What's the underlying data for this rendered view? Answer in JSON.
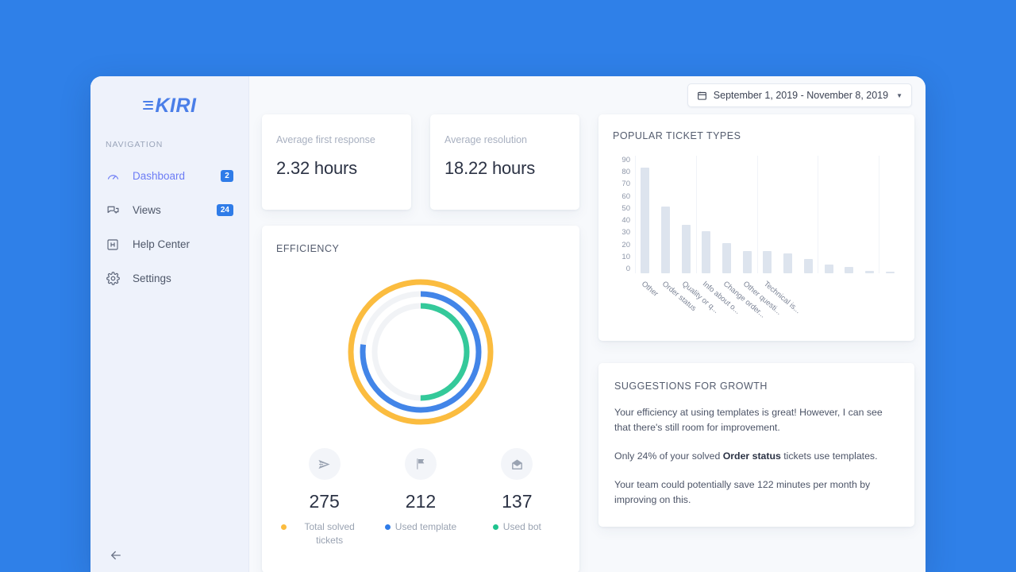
{
  "brand": {
    "name": "KIRI",
    "color": "#4a7ee8"
  },
  "sidebar": {
    "section_label": "NAVIGATION",
    "collapse_icon": "arrow-left-icon",
    "items": [
      {
        "label": "Dashboard",
        "badge": "2",
        "icon": "gauge-icon",
        "active": true
      },
      {
        "label": "Views",
        "badge": "24",
        "icon": "chat-bubbles-icon",
        "active": false
      },
      {
        "label": "Help Center",
        "badge": "",
        "icon": "help-box-icon",
        "active": false
      },
      {
        "label": "Settings",
        "badge": "",
        "icon": "gear-icon",
        "active": false
      }
    ]
  },
  "topbar": {
    "date_range": "September 1, 2019 - November 8, 2019",
    "calendar_icon": "calendar-icon",
    "caret_icon": "chevron-down-icon"
  },
  "metrics": [
    {
      "label": "Average first response",
      "value": "2.32 hours"
    },
    {
      "label": "Average resolution",
      "value": "18.22 hours"
    }
  ],
  "efficiency": {
    "title": "EFFICIENCY",
    "rings": [
      {
        "name": "Total solved tickets",
        "percent": 100,
        "color": "#fbbc3f"
      },
      {
        "name": "Used template",
        "percent": 77,
        "color": "#4285e8"
      },
      {
        "name": "Used bot",
        "percent": 50,
        "color": "#34c99a"
      }
    ],
    "stats": [
      {
        "value": "275",
        "label": "Total solved tickets",
        "color": "#fbbc3f",
        "icon": "send-icon"
      },
      {
        "value": "212",
        "label": "Used template",
        "color": "#2f7ce8",
        "icon": "flag-icon"
      },
      {
        "value": "137",
        "label": "Used bot",
        "color": "#1fc38e",
        "icon": "envelope-icon"
      }
    ]
  },
  "suggestions": {
    "title": "SUGGESTIONS FOR GROWTH",
    "paragraphs": [
      "Your efficiency at using templates is great! However, I can see that there's still room for improvement.",
      "Only 24% of your solved ",
      " tickets use templates.",
      "Your team could potentially save 122 minutes per month by improving on this."
    ],
    "highlight": "Order status"
  },
  "chart_data": {
    "type": "bar",
    "title": "POPULAR TICKET TYPES",
    "xlabel": "",
    "ylabel": "",
    "ylim": [
      0,
      90
    ],
    "yticks": [
      90,
      80,
      70,
      60,
      50,
      40,
      30,
      20,
      10,
      0
    ],
    "grid": "vertical-light",
    "legend": "none",
    "bar_color": "#dde4ee",
    "categories": [
      "Other",
      "Order status",
      "Quality or q...",
      "Info about o...",
      "Change order...",
      "Other questi...",
      "Technical is...",
      "",
      "",
      "",
      "",
      "",
      ""
    ],
    "values": [
      81,
      51,
      37,
      32,
      23,
      17,
      17,
      15,
      11,
      7,
      5,
      2,
      1
    ]
  }
}
